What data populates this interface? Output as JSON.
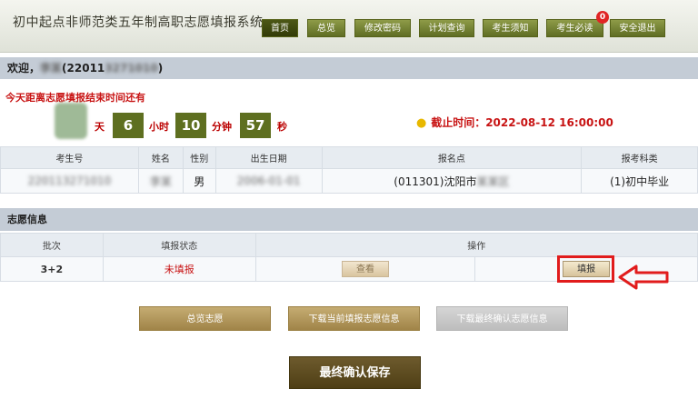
{
  "header": {
    "title": "初中起点非师范类五年制高职志愿填报系统",
    "nav": [
      {
        "label": "首页",
        "active": true
      },
      {
        "label": "总览",
        "active": false
      },
      {
        "label": "修改密码",
        "active": false
      },
      {
        "label": "计划查询",
        "active": false
      },
      {
        "label": "考生须知",
        "active": false
      },
      {
        "label": "考生必读",
        "active": false
      },
      {
        "label": "安全退出",
        "active": false
      }
    ],
    "notice_badge": "0"
  },
  "welcome": {
    "prefix": "欢迎，",
    "name_masked": "李某",
    "id_open": "(22011",
    "id_masked": "3271010",
    "id_close": ")"
  },
  "countdown": {
    "label": "今天距离志愿填报结束时间还有",
    "days_unit": "天",
    "hours": "6",
    "hours_unit": "小时",
    "minutes": "10",
    "minutes_unit": "分钟",
    "seconds": "57",
    "seconds_unit": "秒",
    "deadline_label": "截止时间：",
    "deadline_value": "2022-08-12 16:00:00"
  },
  "student_table": {
    "headers": [
      "考生号",
      "姓名",
      "性别",
      "出生日期",
      "报名点",
      "报考科类"
    ],
    "row": {
      "exam_no": "220113271010",
      "name": "李某",
      "gender": "男",
      "birth": "2006-01-01",
      "site_code": "(011301)沈阳市",
      "site_masked": "某某区",
      "category": "(1)初中毕业"
    }
  },
  "volunteer": {
    "section_title": "志愿信息",
    "headers": [
      "批次",
      "填报状态",
      "操作"
    ],
    "row": {
      "batch": "3+2",
      "status": "未填报",
      "view_label": "查看",
      "fill_label": "填报"
    }
  },
  "actions": {
    "overview": "总览志愿",
    "download_current": "下载当前填报志愿信息",
    "download_final": "下载最终确认志愿信息",
    "final_save": "最终确认保存"
  },
  "colors": {
    "nav_green": "#5f6d24",
    "countdown_green": "#5e6f20",
    "alert_red": "#c81414",
    "gold": "#a08448",
    "dark_brown": "#4f3f15"
  }
}
